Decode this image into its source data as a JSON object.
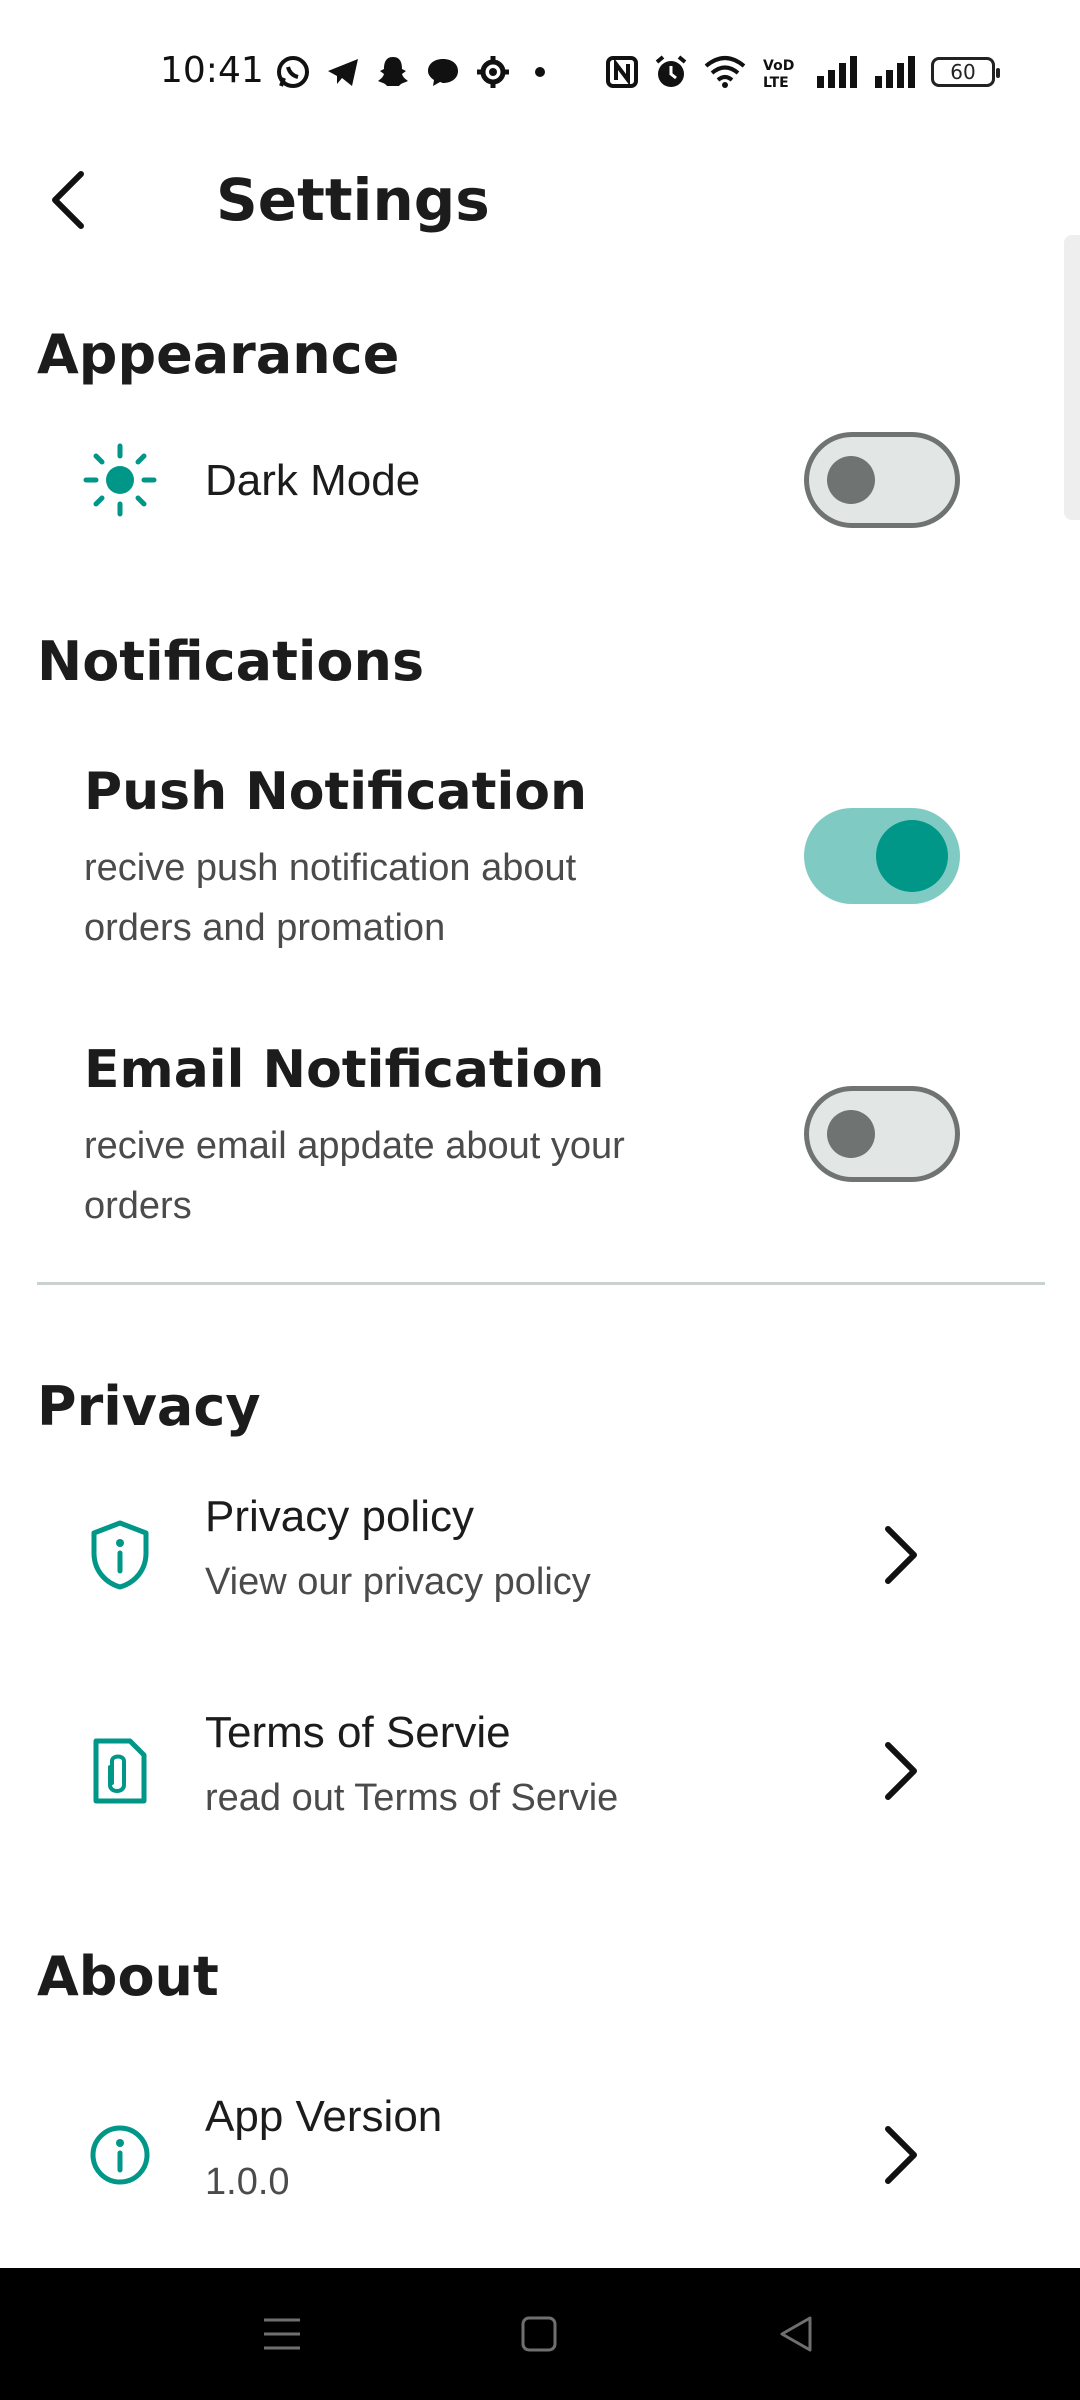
{
  "status_bar": {
    "time": "10:41",
    "battery": "60",
    "icons": [
      "whatsapp-icon",
      "telegram-icon",
      "snapchat-icon",
      "chat-icon",
      "settings-icon",
      "dot-icon",
      "nfc-icon",
      "alarm-icon",
      "wifi-icon",
      "volte-icon",
      "signal-icon",
      "signal-icon"
    ]
  },
  "app_bar": {
    "title": "Settings",
    "back_icon": "chevron-left-icon"
  },
  "sections": {
    "appearance": {
      "heading": "Appearance",
      "dark_mode": {
        "label": "Dark Mode",
        "enabled": false,
        "icon": "sun-icon"
      }
    },
    "notifications": {
      "heading": "Notifications",
      "push": {
        "title": "Push Notification",
        "subtitle_line1": "recive push notification about",
        "subtitle_line2": "orders and promation",
        "enabled": true
      },
      "email": {
        "title": "Email Notification",
        "subtitle_line1": "recive email appdate about your",
        "subtitle_line2": "orders",
        "enabled": false
      }
    },
    "privacy": {
      "heading": "Privacy",
      "policy": {
        "title": "Privacy policy",
        "subtitle": "View our privacy policy",
        "icon": "shield-info-icon"
      },
      "terms": {
        "title": "Terms of Servie",
        "subtitle": "read out Terms of Servie",
        "icon": "document-clip-icon"
      }
    },
    "about": {
      "heading": "About",
      "version": {
        "title": "App Version",
        "subtitle": "1.0.0",
        "icon": "info-icon"
      }
    }
  },
  "colors": {
    "accent": "#009688",
    "switch_on_track": "#7fcbc3",
    "switch_off_track": "#e2e6e5",
    "switch_off_thumb": "#6f7472",
    "divider": "#c9d2d1",
    "nav_bar": "#000000"
  },
  "nav_bar": {
    "buttons": [
      "menu-icon",
      "home-square-icon",
      "back-triangle-icon"
    ]
  }
}
